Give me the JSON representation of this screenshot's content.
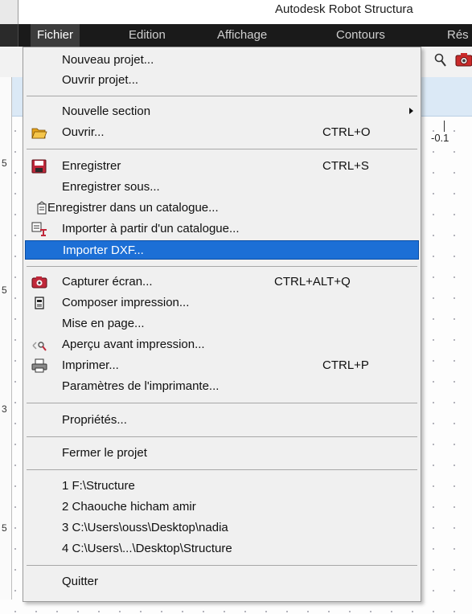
{
  "window": {
    "title": "Autodesk Robot Structura"
  },
  "menubar": {
    "items": [
      {
        "label": "Fichier"
      },
      {
        "label": "Edition"
      },
      {
        "label": "Affichage"
      },
      {
        "label": "Contours"
      },
      {
        "label": "Rés"
      }
    ]
  },
  "workspace": {
    "ruler_top": "-0.1",
    "ruler_left": [
      "5",
      "5",
      "3",
      "5"
    ]
  },
  "menu": {
    "items": [
      {
        "label": "Nouveau projet..."
      },
      {
        "label": "Ouvrir projet..."
      },
      {
        "label": "Nouvelle section"
      },
      {
        "label": "Ouvrir...",
        "shortcut": "CTRL+O",
        "icon": "open-folder-icon"
      },
      {
        "label": "Enregistrer",
        "shortcut": "CTRL+S",
        "icon": "save-icon"
      },
      {
        "label": "Enregistrer sous..."
      },
      {
        "label": "Enregistrer dans un catalogue...",
        "icon": "catalog-save-icon"
      },
      {
        "label": "Importer à partir d'un catalogue...",
        "icon": "catalog-import-icon"
      },
      {
        "label": "Importer DXF..."
      },
      {
        "label": "Capturer écran...",
        "shortcut": "CTRL+ALT+Q",
        "icon": "camera-icon"
      },
      {
        "label": "Composer impression...",
        "icon": "compose-print-icon"
      },
      {
        "label": "Mise en page..."
      },
      {
        "label": "Aperçu avant impression...",
        "icon": "print-preview-icon"
      },
      {
        "label": "Imprimer...",
        "shortcut": "CTRL+P",
        "icon": "printer-icon"
      },
      {
        "label": "Paramètres de l'imprimante..."
      },
      {
        "label": "Propriétés..."
      },
      {
        "label": "Fermer le projet"
      },
      {
        "label": "1 F:\\Structure"
      },
      {
        "label": "2 Chaouche hicham amir"
      },
      {
        "label": "3 C:\\Users\\ouss\\Desktop\\nadia"
      },
      {
        "label": "4 C:\\Users\\...\\Desktop\\Structure"
      },
      {
        "label": "Quitter"
      }
    ]
  }
}
